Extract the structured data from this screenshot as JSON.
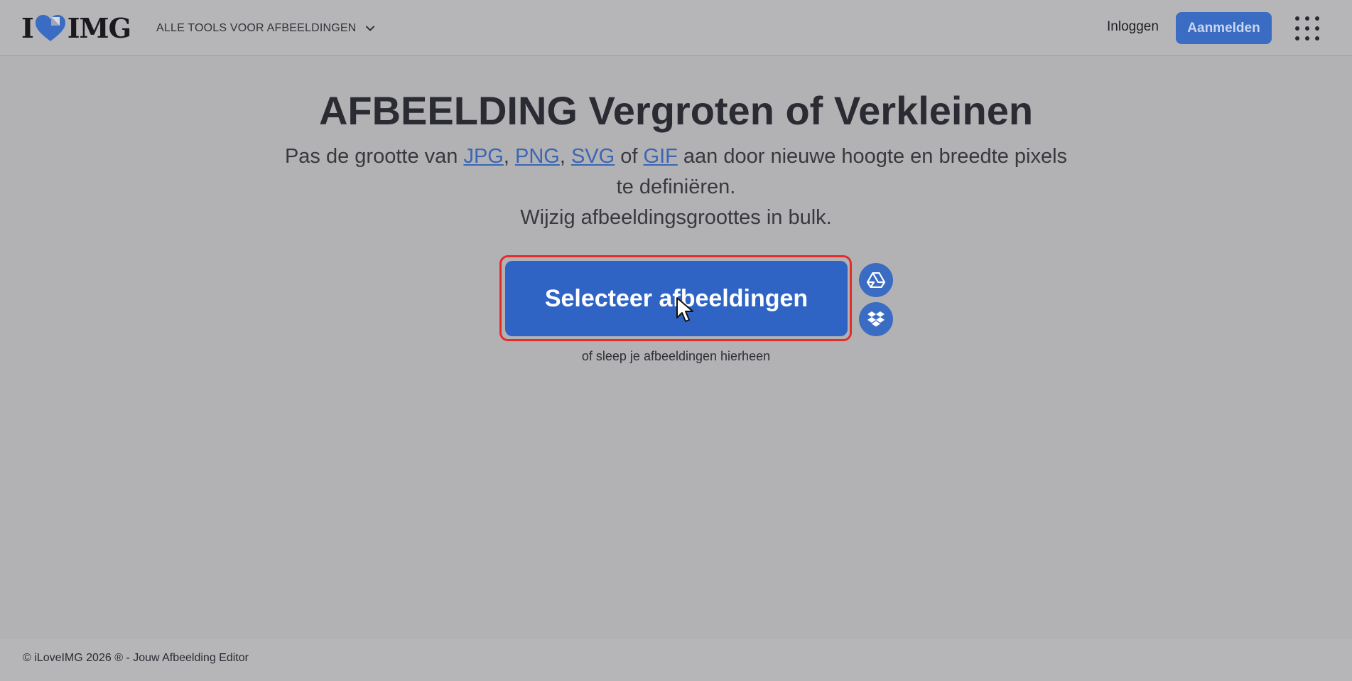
{
  "header": {
    "logo_left": "I",
    "logo_right": "IMG",
    "tools_menu_label": "ALLE TOOLS VOOR AFBEELDINGEN",
    "login_label": "Inloggen",
    "signup_label": "Aanmelden"
  },
  "hero": {
    "title": "AFBEELDING Vergroten of Verkleinen",
    "subtitle_prefix": "Pas de grootte van ",
    "format_links": [
      "JPG",
      "PNG",
      "SVG",
      "GIF"
    ],
    "sep_comma": ", ",
    "sep_of": " of ",
    "subtitle_suffix": " aan door nieuwe hoogte en breedte pixels te definiëren.",
    "subtitle_line2": "Wijzig afbeeldingsgroottes in bulk.",
    "select_button_label": "Selecteer afbeeldingen",
    "drop_hint": "of sleep je afbeeldingen hierheen"
  },
  "cloud_buttons": {
    "drive_icon": "google-drive-icon",
    "dropbox_icon": "dropbox-icon"
  },
  "footer": {
    "text": "© iLoveIMG 2026 ® - Jouw Afbeelding Editor"
  },
  "colors": {
    "overlay_background": "#b2b2b4",
    "brand_blue": "#2f64c4",
    "highlight_outline": "#e52b2b",
    "link_blue": "#3a66b4"
  }
}
